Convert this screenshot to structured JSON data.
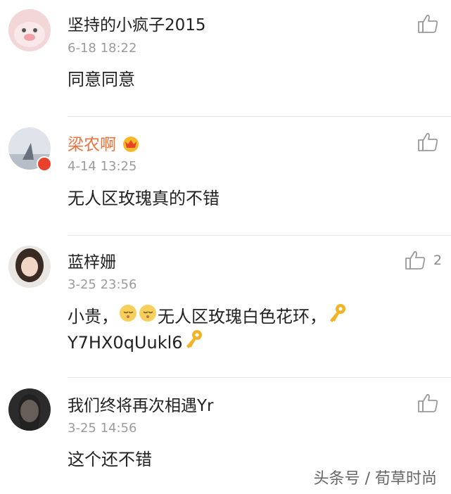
{
  "comments": [
    {
      "username": "坚持的小疯子2015",
      "time": "6-18 18:22",
      "text": "同意同意",
      "likes": ""
    },
    {
      "username": "梁农啊",
      "time": "4-14 13:25",
      "text": "无人区玫瑰真的不错",
      "likes": "",
      "vip_badge_icon": "crown-icon"
    },
    {
      "username": "蓝梓姗",
      "time": "3-25 23:56",
      "text_line1_a": "小贵，",
      "text_line1_b": "无人区玫瑰白色花环，",
      "text_line2": "Y7HX0qUukl6",
      "likes": "2"
    },
    {
      "username": "我们终将再次相遇Yr",
      "time": "3-25 14:56",
      "text": "这个还不错",
      "likes": ""
    }
  ],
  "watermark": "头条号 / 荀草时尚",
  "colors": {
    "vip_name": "#eb7340",
    "name": "#222222",
    "time": "#9c9c9c",
    "divider": "#e6e6e6"
  }
}
